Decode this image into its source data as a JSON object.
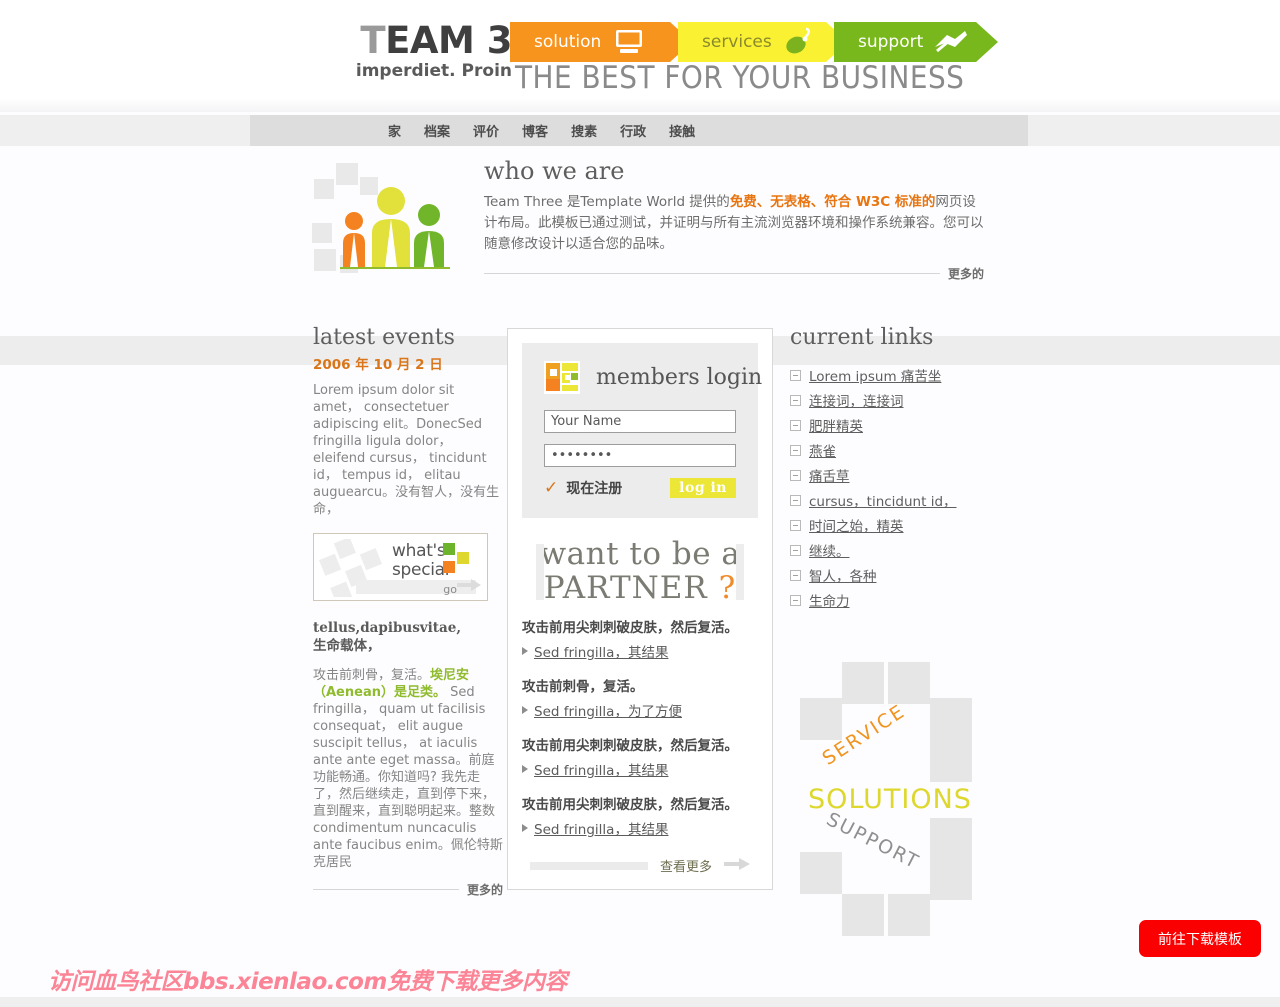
{
  "header": {
    "brand_t": "T",
    "brand_rest": "EAM 3",
    "brand_sub": "imperdiet. Proin",
    "tagline": "THE BEST FOR YOUR BUSINESS",
    "ribbons": [
      {
        "label": "solution",
        "icon": "monitor-icon",
        "color": "#f7941e"
      },
      {
        "label": "services",
        "icon": "mouse-icon",
        "color": "#fbf133"
      },
      {
        "label": "support",
        "icon": "handshake-icon",
        "color": "#78b81c"
      }
    ]
  },
  "nav": {
    "items": [
      {
        "label": "家"
      },
      {
        "label": "档案"
      },
      {
        "label": "评价"
      },
      {
        "label": "博客"
      },
      {
        "label": "搜素"
      },
      {
        "label": "行政"
      },
      {
        "label": "接触"
      }
    ]
  },
  "who_we_are": {
    "title": "who we are",
    "text_pre": "Team Three 是Template World 提供的",
    "text_highlight": "免费、无表格、符合 W3C 标准的",
    "text_post": "网页设计布局。此模板已通过测试，并证明与所有主流浏览器环境和操作系统兼容。您可以随意修改设计以适合您的品味。",
    "more_label": "更多的"
  },
  "latest_events": {
    "title": "latest events",
    "date": "2006 年 10 月 2 日",
    "body": "Lorem ipsum dolor sit amet， consectetuer adipiscing elit。DonecSed fringilla ligula dolor， eleifend cursus， tincidunt id， tempus id， elitau auguearcu。没有智人，没有生命，",
    "whats_special": {
      "line1": "what's",
      "line2": "special",
      "go_label": "go"
    },
    "tellus_title_l1": "tellus,dapibusvitae,",
    "tellus_title_l2": "生命载体，",
    "tellus_pre": "攻击前刺骨，复活。",
    "tellus_green": "埃尼安（Aenean）是足类。",
    "tellus_post": " Sed fringilla， quam ut facilisis consequat， elit augue suscipit tellus， at iaculis ante ante eget massa。前庭功能畅通。你知道吗? 我先走了，然后继续走，直到停下来，直到醒来，直到聪明起来。整数 condimentum nuncaculis ante faucibus enim。佩伦特斯克居民",
    "more_label": "更多的"
  },
  "login": {
    "title": "members login",
    "logo_icon": "members-logo-icon",
    "username_placeholder": "Your Name",
    "username_value": "",
    "password_value": "••••••••",
    "register_label": "现在注册",
    "check_icon": "check-icon",
    "submit_label": "log in"
  },
  "partner": {
    "line1": "want to be a",
    "line2": "PARTNER",
    "question_mark": "?",
    "items": [
      {
        "title": "攻击前用尖刺刺破皮肤，然后复活。",
        "link": "Sed fringilla，其结果"
      },
      {
        "title": "攻击前刺骨，复活。",
        "link": "Sed fringilla，为了方便"
      },
      {
        "title": "攻击前用尖刺刺破皮肤，然后复活。",
        "link": "Sed fringilla，其结果"
      },
      {
        "title": "攻击前用尖刺刺破皮肤，然后复活。",
        "link": "Sed fringilla，其结果"
      }
    ],
    "view_more": "查看更多"
  },
  "current_links": {
    "title": "current links",
    "items": [
      {
        "label": "Lorem ipsum 痛苦坐"
      },
      {
        "label": "连接词，连接词"
      },
      {
        "label": "肥胖精英"
      },
      {
        "label": "燕雀"
      },
      {
        "label": "痛舌草"
      },
      {
        "label": "cursus，tincidunt id，"
      },
      {
        "label": "时间之始，精英"
      },
      {
        "label": "继续。"
      },
      {
        "label": "智人，各种"
      },
      {
        "label": "生命力"
      }
    ]
  },
  "service_graphic": {
    "service": "SERVICE",
    "solutions": "SOLUTIONS",
    "support": "SUPPORT",
    "colors": {
      "service": "#f0941e",
      "solutions": "#ddd72e",
      "support": "#8f8f8f"
    }
  },
  "footer": {
    "watermark": "访问血鸟社区bbs.xienlao.com免费下载更多内容",
    "watermark_color": "#fb8596",
    "download_button": "前往下载模板",
    "download_button_color": "#fb0000"
  }
}
